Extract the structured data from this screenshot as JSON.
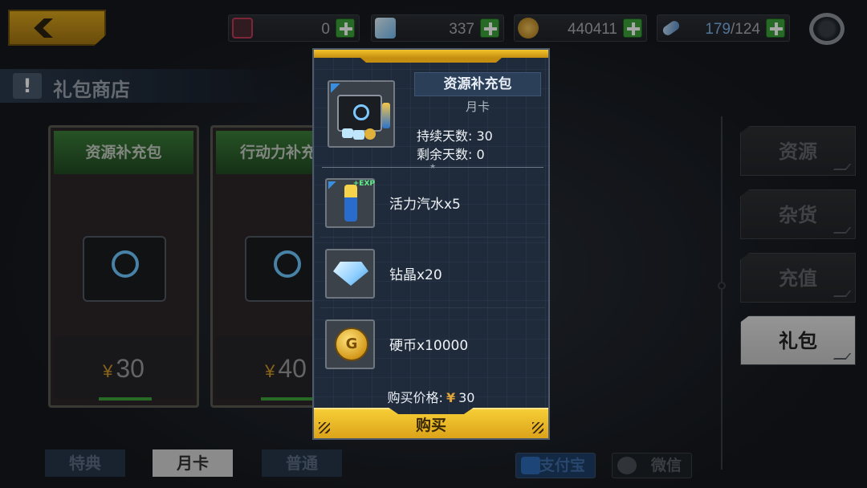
{
  "header": {
    "resources": [
      {
        "icon": "ticket-icon",
        "value": "0",
        "color": "#c43a5a"
      },
      {
        "icon": "crystal-icon",
        "value": "337",
        "color": "#8fcfff"
      },
      {
        "icon": "coin-icon",
        "value": "440411",
        "color": "#d8a535"
      },
      {
        "icon": "energy-icon",
        "value_current": "179",
        "value_sep": "/",
        "value_max": "124",
        "color": "#7fb3e8"
      }
    ]
  },
  "title": {
    "text": "礼包商店"
  },
  "cards": [
    {
      "name": "资源补充包",
      "price": "30",
      "currency": "¥"
    },
    {
      "name": "行动力补充包",
      "price": "40",
      "currency": "¥"
    }
  ],
  "side_tabs": [
    "资源",
    "杂货",
    "充值",
    "礼包"
  ],
  "active_side_tab": "礼包",
  "bottom_tabs": [
    "特典",
    "月卡",
    "普通"
  ],
  "active_bottom_tab": "月卡",
  "payment": {
    "alipay": "支付宝",
    "wechat": "微信"
  },
  "modal": {
    "pack_name": "资源补充包",
    "pack_type": "月卡",
    "duration_label": "持续天数:",
    "duration_value": "30",
    "remaining_label": "剩余天数:",
    "remaining_value": "0",
    "items": [
      {
        "label": "活力汽水x5",
        "icon": "soda-bottle-icon",
        "tag": "+EXP"
      },
      {
        "label": "钻晶x20",
        "icon": "crystal-icon"
      },
      {
        "label": "硬币x10000",
        "icon": "coin-icon",
        "glyph": "G"
      }
    ],
    "price_label": "购买价格:",
    "price_currency": "¥",
    "price_value": "30",
    "buy_label": "购买"
  }
}
